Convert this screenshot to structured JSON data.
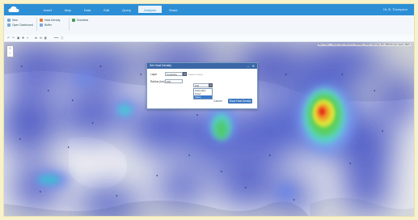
{
  "header": {
    "tabs": [
      "Insert",
      "Map",
      "Data",
      "Edit",
      "Query",
      "Analysis",
      "Share"
    ],
    "active_tab_index": 5,
    "user": "Hi, B. Thompson"
  },
  "ribbon": {
    "groups": [
      {
        "items": [
          "New",
          "Open Dashboard"
        ]
      },
      {
        "items": [
          "Heat Density",
          "Buffer"
        ]
      },
      {
        "items": [
          "Drivetime"
        ]
      }
    ]
  },
  "map": {
    "attribution": "Tiles © Esri — Source: Esri, DeLorme, NAVTEQ, USGS, Intermap, iPC, NRCAN, Esri Japan, METI",
    "zoom_in": "+",
    "zoom_out": "−"
  },
  "dialog": {
    "title": "Set Heat Density",
    "layer_label": "Layer",
    "layer_value": "Countries",
    "layer_hint": "Select a layer",
    "radius_label": "Radius (km)",
    "radius_value": "100",
    "dropdown_value": "100",
    "dropdown_options": [
      "Automatic",
      "Fixed",
      "Value"
    ],
    "dropdown_selected_index": 2,
    "cancel_label": "Cancel",
    "apply_label": "Show Heat Density"
  }
}
